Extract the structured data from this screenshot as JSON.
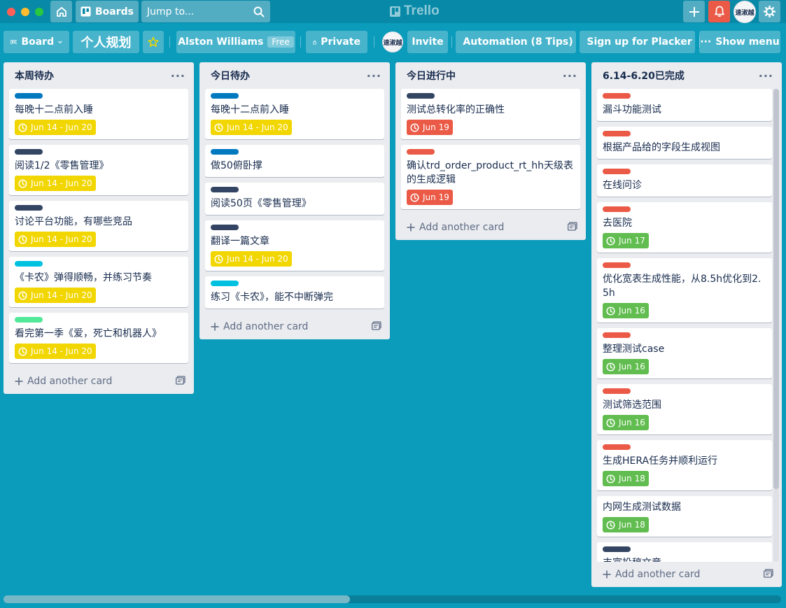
{
  "header": {
    "boards_label": "Boards",
    "search_placeholder": "Jump to...",
    "logo_text": "Trello",
    "avatar_text": "速淑越"
  },
  "board": {
    "board_button": "Board",
    "title": "个人规划",
    "team_name": "Alston Williams",
    "team_badge": "Free",
    "visibility": "Private",
    "invite": "Invite",
    "automation": "Automation (8 Tips)",
    "placker": "Sign up for Placker",
    "show_menu": "Show menu"
  },
  "colors": {
    "label_blue": "#0079bf",
    "label_navy": "#344563",
    "label_sky": "#00c2e0",
    "label_lime": "#51e898",
    "label_red": "#eb5a46",
    "due_yellow": "#f2d600",
    "due_red": "#eb5a46",
    "due_green": "#61bd4f"
  },
  "add_card_label": "Add another card",
  "lists": [
    {
      "title": "本周待办",
      "cards": [
        {
          "label": "blue",
          "title": "每晚十二点前入睡",
          "due": "Jun 14 - Jun 20",
          "due_status": "yellow"
        },
        {
          "label": "navy",
          "title": "阅读1/2《零售管理》",
          "due": "Jun 14 - Jun 20",
          "due_status": "yellow"
        },
        {
          "label": "navy",
          "title": "讨论平台功能，有哪些竞品",
          "due": "Jun 14 - Jun 20",
          "due_status": "yellow"
        },
        {
          "label": "sky",
          "title": "《卡农》弹得顺畅，并练习节奏",
          "due": "Jun 14 - Jun 20",
          "due_status": "yellow"
        },
        {
          "label": "lime",
          "title": "看完第一季《爱，死亡和机器人》",
          "due": "Jun 14 - Jun 20",
          "due_status": "yellow"
        }
      ]
    },
    {
      "title": "今日待办",
      "cards": [
        {
          "label": "blue",
          "title": "每晚十二点前入睡",
          "due": "Jun 14 - Jun 20",
          "due_status": "yellow"
        },
        {
          "label": "blue",
          "title": "做50俯卧撑",
          "due": "",
          "due_status": ""
        },
        {
          "label": "navy",
          "title": "阅读50页《零售管理》",
          "due": "",
          "due_status": ""
        },
        {
          "label": "navy",
          "title": "翻译一篇文章",
          "due": "Jun 14 - Jun 20",
          "due_status": "yellow"
        },
        {
          "label": "sky",
          "title": "练习《卡农》，能不中断弹完",
          "due": "",
          "due_status": ""
        }
      ]
    },
    {
      "title": "今日进行中",
      "cards": [
        {
          "label": "navy",
          "title": "测试总转化率的正确性",
          "due": "Jun 19",
          "due_status": "red"
        },
        {
          "label": "red",
          "title": "确认trd_order_product_rt_hh天级表的生成逻辑",
          "due": "Jun 19",
          "due_status": "red"
        }
      ]
    },
    {
      "title": "6.14-6.20已完成",
      "cards": [
        {
          "label": "red",
          "title": "漏斗功能测试",
          "due": "",
          "due_status": ""
        },
        {
          "label": "red",
          "title": "根据产品给的字段生成视图",
          "due": "",
          "due_status": ""
        },
        {
          "label": "red",
          "title": "在线问诊",
          "due": "",
          "due_status": ""
        },
        {
          "label": "red",
          "title": "去医院",
          "due": "Jun 17",
          "due_status": "green"
        },
        {
          "label": "red",
          "title": "优化宽表生成性能，从8.5h优化到2.5h",
          "due": "Jun 16",
          "due_status": "green"
        },
        {
          "label": "red",
          "title": "整理测试case",
          "due": "Jun 16",
          "due_status": "green"
        },
        {
          "label": "red",
          "title": "测试筛选范围",
          "due": "Jun 16",
          "due_status": "green"
        },
        {
          "label": "red",
          "title": "生成HERA任务并顺利运行",
          "due": "Jun 18",
          "due_status": "green"
        },
        {
          "label": "",
          "title": "内网生成测试数据",
          "due": "Jun 18",
          "due_status": "green"
        },
        {
          "label": "navy",
          "title": "丰富投稿文章",
          "due": "",
          "due_status": ""
        }
      ]
    }
  ]
}
